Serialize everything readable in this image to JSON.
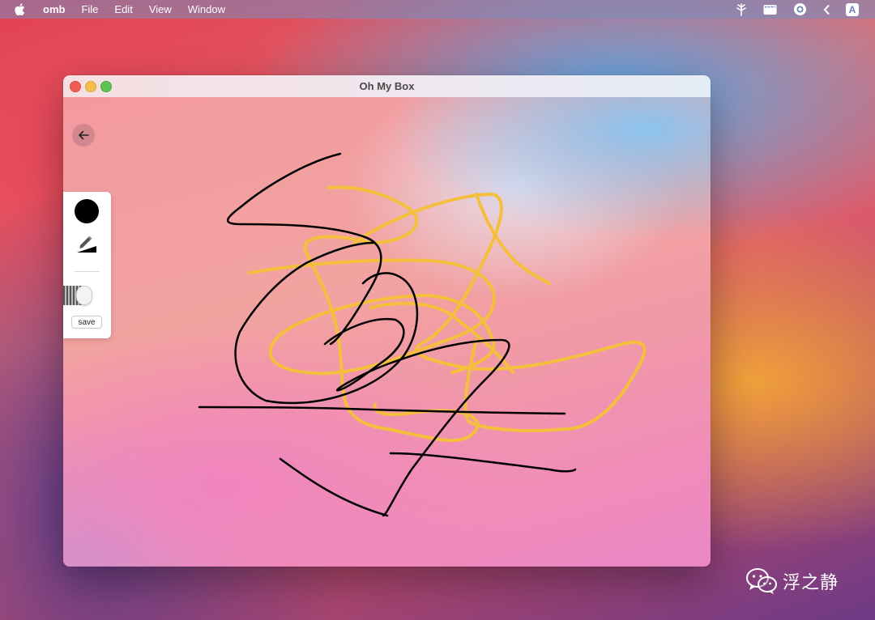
{
  "menubar": {
    "app_name": "omb",
    "items": [
      "File",
      "Edit",
      "View",
      "Window"
    ],
    "tray_icons": [
      "tree-icon",
      "clapperboard-icon",
      "record-icon",
      "chevron-left-icon",
      "input-source-icon"
    ],
    "input_source_label": "A"
  },
  "window": {
    "title": "Oh My Box",
    "traffic_lights": [
      "close",
      "minimize",
      "zoom"
    ]
  },
  "canvas": {
    "back_icon": "arrow-left-icon",
    "stroke_colors": {
      "black": "#000000",
      "yellow": "#f4bf3c"
    }
  },
  "tool_panel": {
    "current_color": "#000000",
    "tool_icon": "pencil-icon",
    "save_label": "save"
  },
  "watermark": {
    "text": "浮之静",
    "icon": "wechat-icon"
  }
}
